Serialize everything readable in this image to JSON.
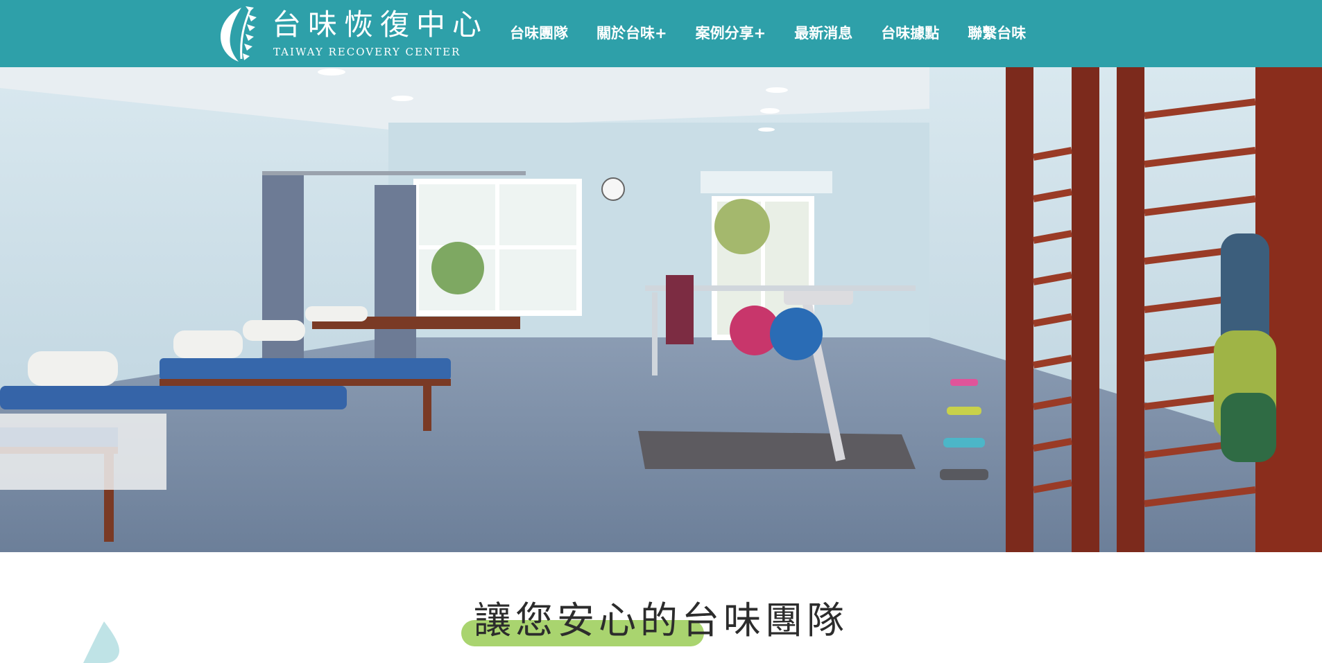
{
  "header": {
    "logo_cn": "台味恢復中心",
    "logo_en": "TAIWAY RECOVERY CENTER",
    "brand_color": "#2ea0a9"
  },
  "nav": {
    "items": [
      {
        "label": "台味團隊"
      },
      {
        "label": "關於台味+"
      },
      {
        "label": "案例分享+"
      },
      {
        "label": "最新消息"
      },
      {
        "label": "台味據點"
      },
      {
        "label": "聯繫台味"
      }
    ]
  },
  "hero": {
    "slide_count": 4,
    "active_slide": 3
  },
  "section": {
    "title": "讓您安心的台味團隊",
    "highlight_color": "#a9d46f"
  }
}
